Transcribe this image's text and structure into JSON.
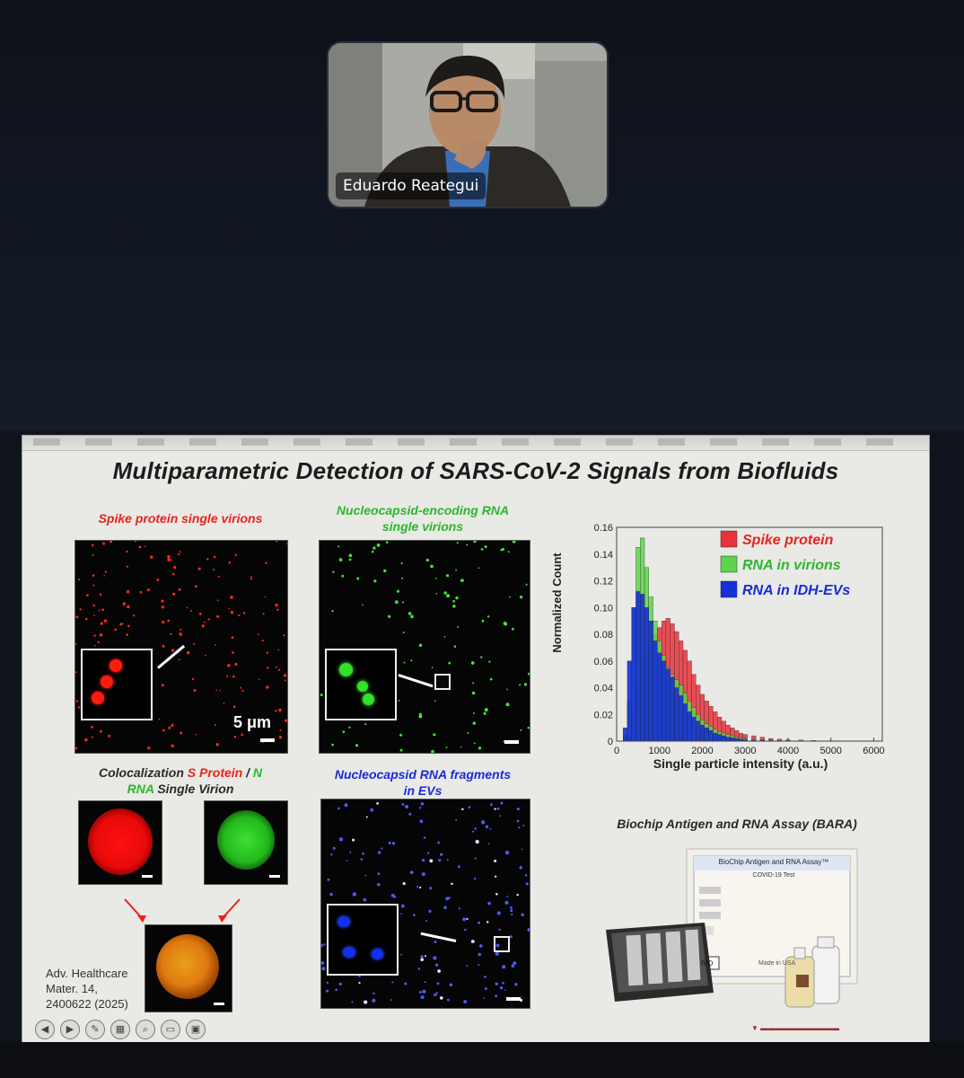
{
  "participant": {
    "name": "Eduardo Reategui"
  },
  "slide": {
    "title": "Multiparametric Detection of SARS-CoV-2 Signals from Biofluids",
    "panel_spike": {
      "caption": "Spike protein single virions",
      "scale": "5 μm"
    },
    "panel_rna": {
      "caption_line1": "Nucleocapsid-encoding RNA",
      "caption_line2": "single virions"
    },
    "panel_coloc": {
      "caption_part1": "Colocalization ",
      "caption_s": "S Protein",
      "caption_slash": " / ",
      "caption_n": "N",
      "caption_rna": "RNA",
      "caption_end": " Single Virion"
    },
    "panel_ev": {
      "caption_line1": "Nucleocapsid RNA fragments",
      "caption_line2": "in EVs"
    },
    "kit": {
      "title": "Biochip Antigen and RNA Assay (BARA)",
      "box_label": "BioChip Antigen and RNA Assay™",
      "box_sub": "COVID-19 Test",
      "made": "Made in USA",
      "ivd": "IVD"
    },
    "reference": {
      "line1": "Adv. Healthcare",
      "line2": "Mater. 14,",
      "line3": "2400622 (2025)"
    }
  },
  "chart_data": {
    "type": "bar",
    "xlabel": "Single particle intensity (a.u.)",
    "ylabel": "Normalized Count",
    "xlim": [
      0,
      6200
    ],
    "ylim": [
      0,
      0.16
    ],
    "xticks": [
      0,
      1000,
      2000,
      3000,
      4000,
      5000,
      6000
    ],
    "yticks": [
      0,
      0.02,
      0.04,
      0.06,
      0.08,
      0.1,
      0.12,
      0.14,
      0.16
    ],
    "legend_position": "top-right",
    "bin_width": 100,
    "x": [
      100,
      200,
      300,
      400,
      500,
      600,
      700,
      800,
      900,
      1000,
      1100,
      1200,
      1300,
      1400,
      1500,
      1600,
      1700,
      1800,
      1900,
      2000,
      2100,
      2200,
      2300,
      2400,
      2500,
      2600,
      2700,
      2800,
      2900,
      3000,
      3200,
      3400,
      3600,
      3800,
      4000,
      4300,
      4600,
      5000
    ],
    "series": [
      {
        "name": "Spike protein",
        "color": "#e8333a",
        "values": [
          0.0,
          0.002,
          0.006,
          0.018,
          0.04,
          0.058,
          0.07,
          0.076,
          0.08,
          0.085,
          0.09,
          0.092,
          0.088,
          0.082,
          0.075,
          0.068,
          0.06,
          0.05,
          0.042,
          0.035,
          0.03,
          0.026,
          0.022,
          0.018,
          0.015,
          0.012,
          0.01,
          0.008,
          0.006,
          0.005,
          0.004,
          0.003,
          0.002,
          0.0015,
          0.001,
          0.0008,
          0.0005,
          0.0003
        ]
      },
      {
        "name": "RNA in virions",
        "color": "#5ed44a",
        "values": [
          0.0,
          0.004,
          0.03,
          0.1,
          0.145,
          0.152,
          0.13,
          0.108,
          0.09,
          0.075,
          0.064,
          0.055,
          0.05,
          0.046,
          0.042,
          0.036,
          0.03,
          0.025,
          0.02,
          0.016,
          0.013,
          0.011,
          0.009,
          0.007,
          0.006,
          0.005,
          0.004,
          0.003,
          0.0025,
          0.002,
          0.0015,
          0.001,
          0.0008,
          0.0006,
          0.0004,
          0.0003,
          0.0002,
          0.0001
        ]
      },
      {
        "name": "RNA in IDH-EVs",
        "color": "#1530d8",
        "values": [
          0.0,
          0.01,
          0.06,
          0.1,
          0.112,
          0.11,
          0.1,
          0.09,
          0.075,
          0.066,
          0.06,
          0.054,
          0.048,
          0.04,
          0.034,
          0.028,
          0.022,
          0.018,
          0.015,
          0.012,
          0.01,
          0.008,
          0.006,
          0.005,
          0.004,
          0.003,
          0.0025,
          0.002,
          0.0015,
          0.001,
          0.0008,
          0.0006,
          0.0004,
          0.0003,
          0.0002,
          0.0001,
          0.0001,
          0.0
        ]
      }
    ]
  }
}
